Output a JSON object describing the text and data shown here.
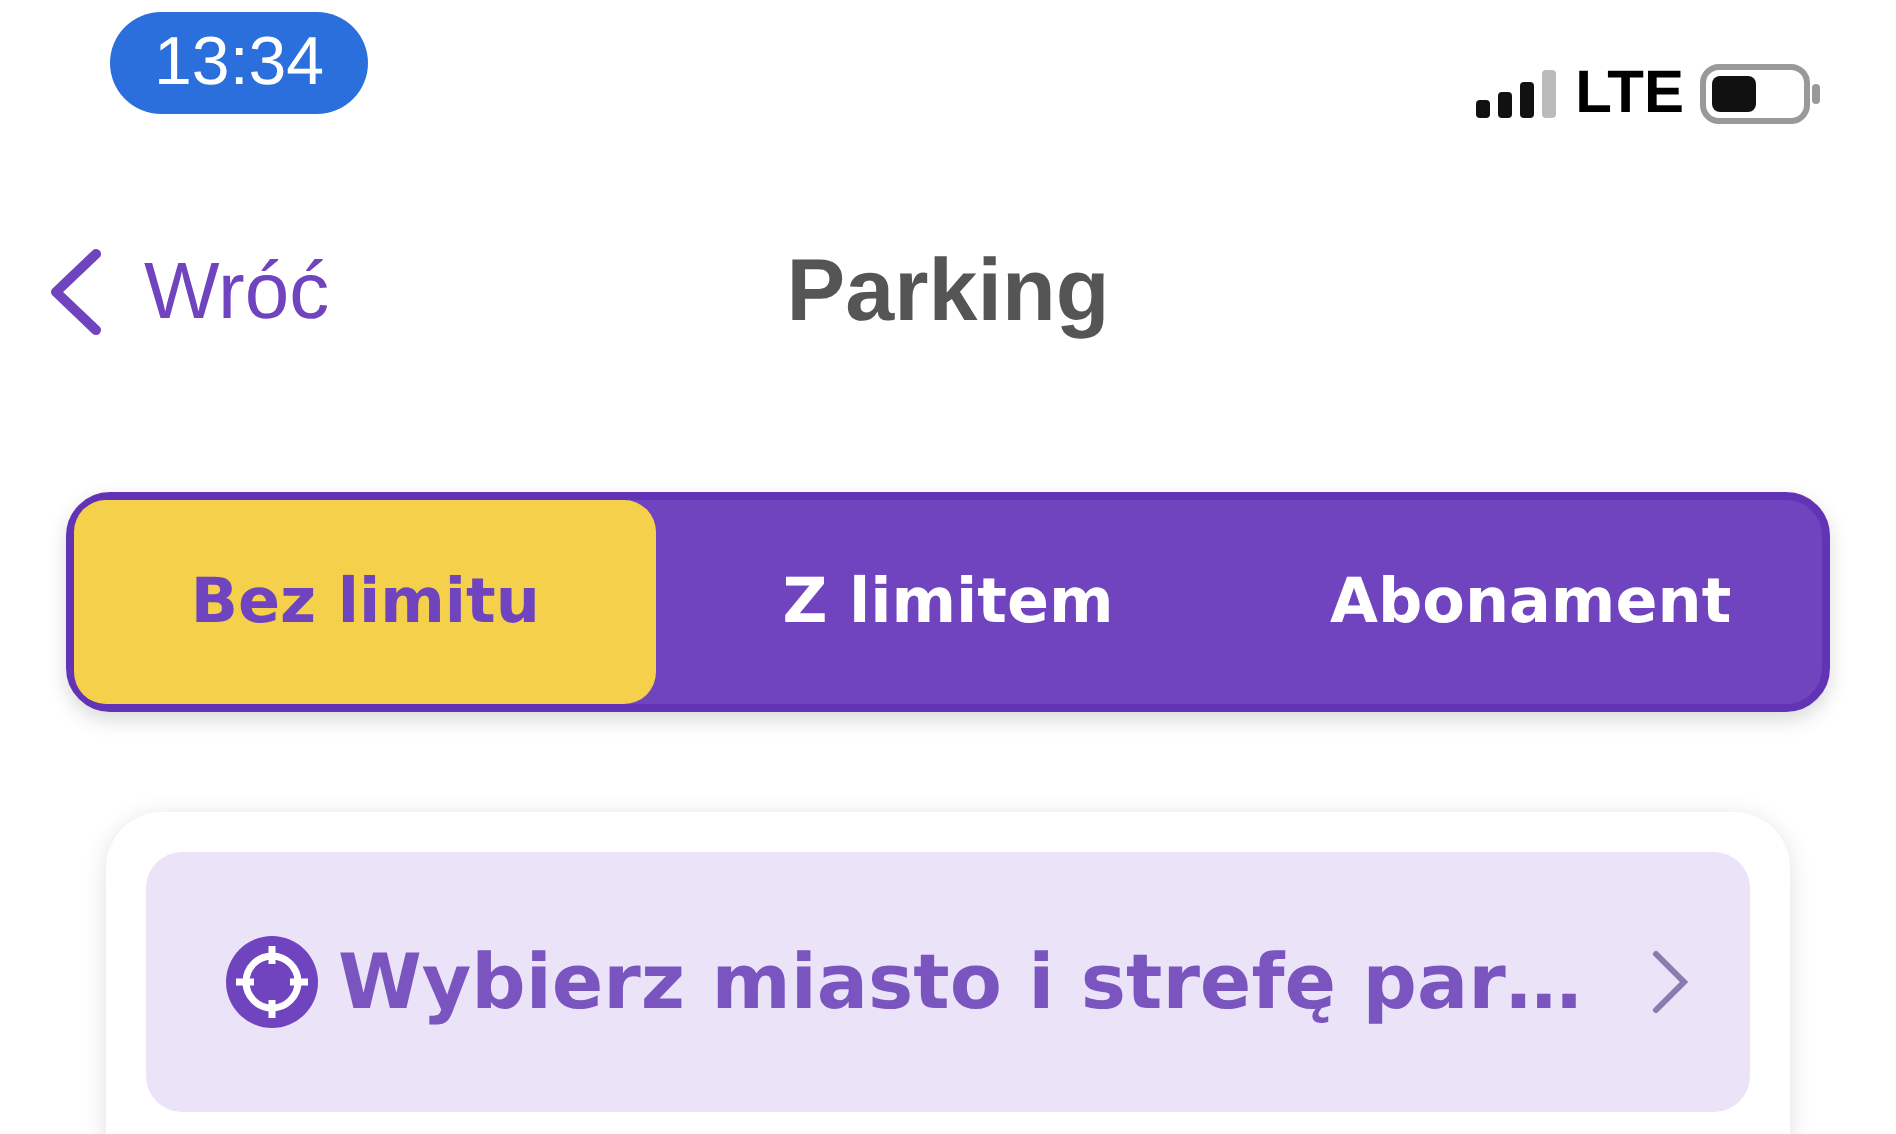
{
  "status_bar": {
    "time": "13:34",
    "network": "LTE"
  },
  "nav": {
    "back_label": "Wróć",
    "title": "Parking"
  },
  "tabs": [
    {
      "label": "Bez limitu",
      "selected": true
    },
    {
      "label": "Z limitem",
      "selected": false
    },
    {
      "label": "Abonament",
      "selected": false
    }
  ],
  "zone_picker": {
    "label": "Wybierz miasto i strefę par…"
  }
}
